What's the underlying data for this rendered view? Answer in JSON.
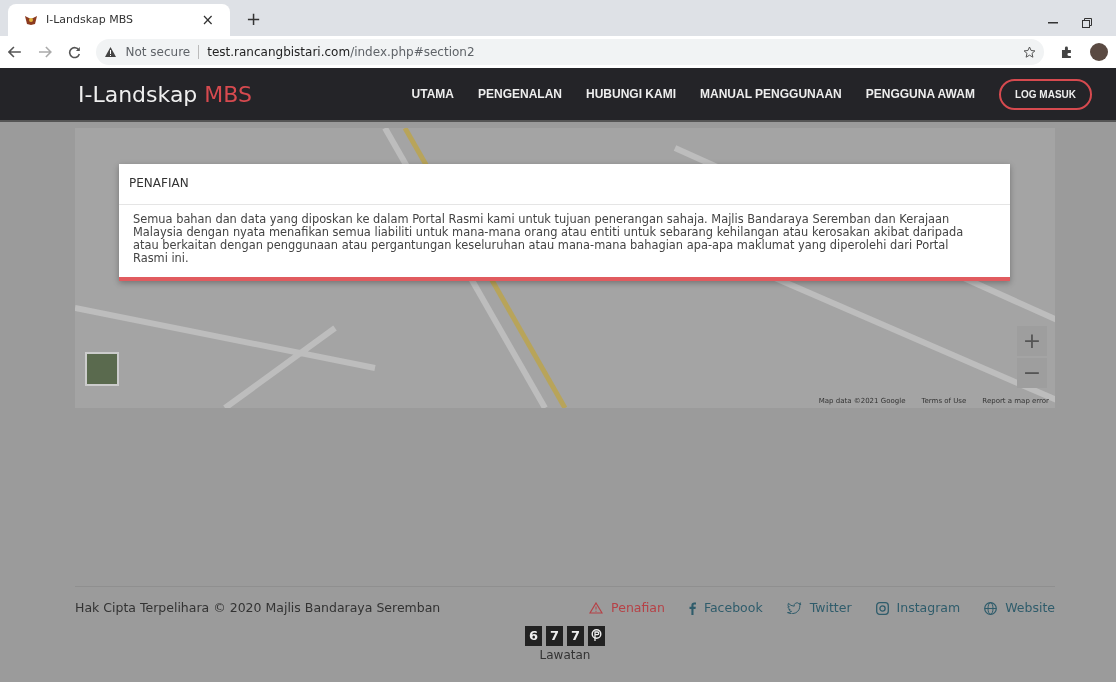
{
  "browser": {
    "tab_title": "I-Landskap MBS",
    "tab_close": "×",
    "new_tab": "+",
    "security": "Not secure",
    "url_host": "test.rancangbistari.com",
    "url_path": "/index.php#section2"
  },
  "navbar": {
    "brand": "I-Landskap",
    "brand_accent": "MBS",
    "items": [
      {
        "label": "UTAMA"
      },
      {
        "label": "PENGENALAN"
      },
      {
        "label": "HUBUNGI KAMI"
      },
      {
        "label": "MANUAL PENGGUNAAN"
      },
      {
        "label": "PENGGUNA AWAM"
      }
    ],
    "login": "LOG MASUK"
  },
  "map": {
    "zoom_in": "+",
    "zoom_out": "−",
    "attribution": [
      "Map data ©2021 Google",
      "Terms of Use",
      "Report a map error"
    ]
  },
  "modal": {
    "title": "PENAFIAN",
    "body": "Semua bahan dan data yang diposkan ke dalam Portal Rasmi kami untuk tujuan penerangan sahaja. Majlis Bandaraya Seremban dan Kerajaan Malaysia dengan nyata menafikan semua liabiliti untuk mana-mana orang atau entiti untuk sebarang kehilangan atau kerosakan akibat daripada atau berkaitan dengan penggunaan atau pergantungan keseluruhan atau mana-mana bahagian apa-apa maklumat yang diperolehi dari Portal Rasmi ini."
  },
  "footer": {
    "copyright": "Hak Cipta Terpelihara © 2020 Majlis Bandaraya Seremban",
    "links": [
      {
        "kind": "disclaimer",
        "label": "Penafian"
      },
      {
        "kind": "facebook",
        "label": "Facebook"
      },
      {
        "kind": "twitter",
        "label": "Twitter"
      },
      {
        "kind": "instagram",
        "label": "Instagram"
      },
      {
        "kind": "website",
        "label": "Website"
      }
    ],
    "counter_digits": [
      "6",
      "7",
      "7"
    ],
    "counter_label": "Lawatan"
  }
}
